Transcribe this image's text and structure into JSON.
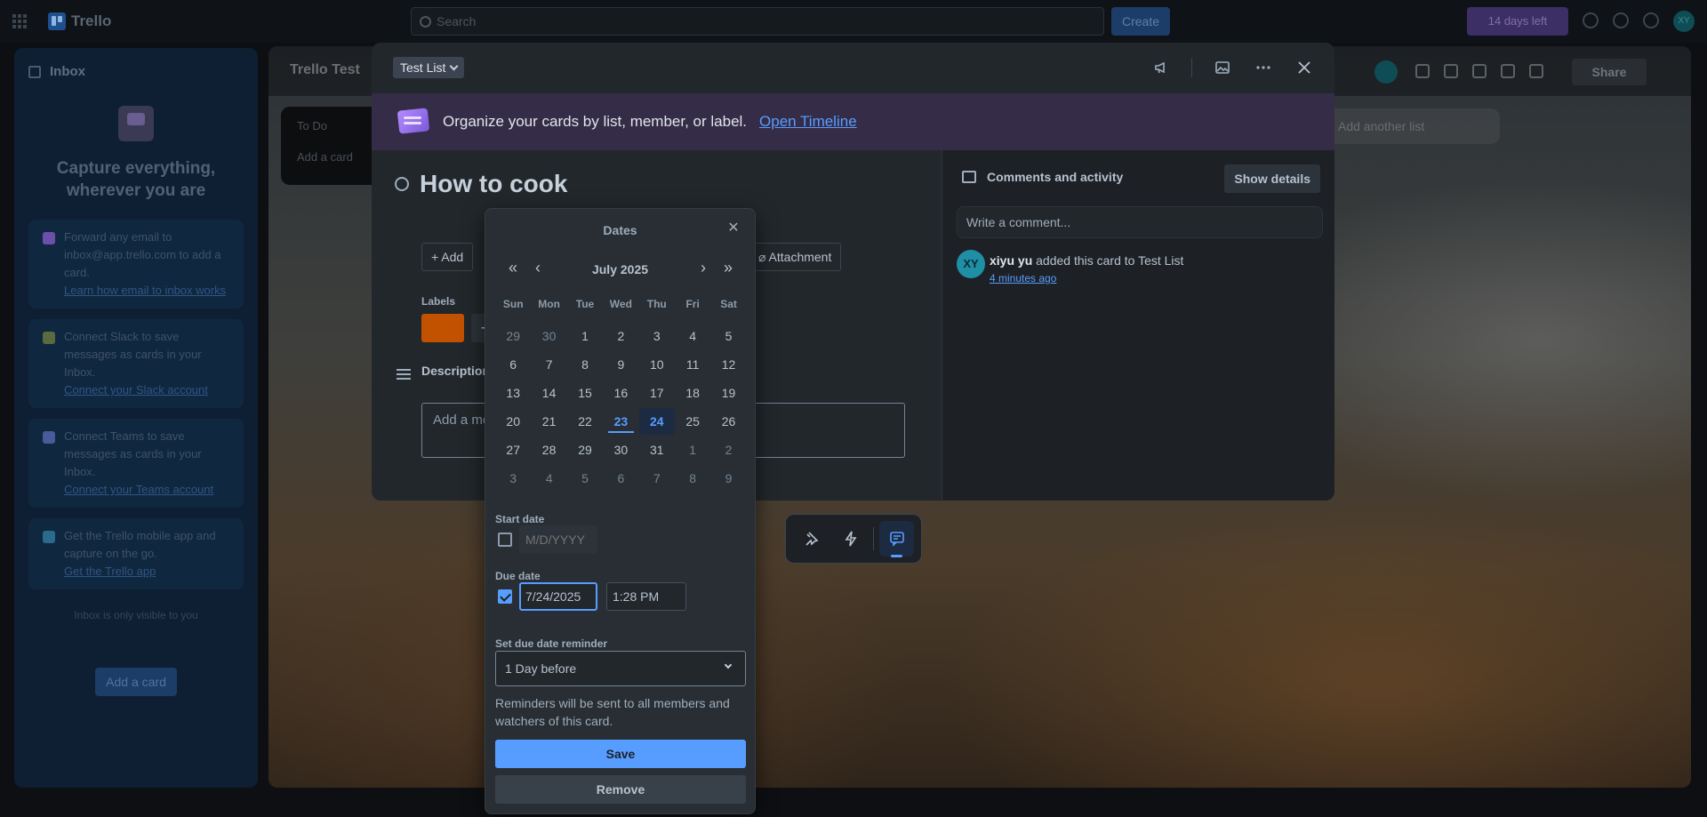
{
  "topbar": {
    "app_name": "Trello",
    "search_placeholder": "Search",
    "create_label": "Create",
    "trial_label": "14 days left",
    "avatar_initials": "XY"
  },
  "inbox": {
    "title": "Inbox",
    "heading": "Capture everything, wherever you are",
    "tips": [
      {
        "text": "Forward any email to inbox@app.trello.com to add a card.",
        "link": "Learn how email to inbox works",
        "color": "#6b4fa8"
      },
      {
        "text": "Connect Slack to save messages as cards in your Inbox.",
        "link": "Connect your Slack account",
        "color": "#5a6b3f"
      },
      {
        "text": "Connect Teams to save messages as cards in your Inbox.",
        "link": "Connect your Teams account",
        "color": "#4a5a9a"
      },
      {
        "text": "Get the Trello mobile app and capture on the go.",
        "link": "Get the Trello app",
        "color": "#2a6a8a"
      }
    ],
    "visibility_note": "Inbox is only visible to you",
    "add_card_label": "Add a card"
  },
  "board": {
    "title": "Trello Test",
    "list_todo": "To Do",
    "add_card": "Add a card",
    "add_list": "Add another list",
    "share_label": "Share"
  },
  "modal": {
    "list_name": "Test List",
    "banner_text": "Organize your cards by list, member, or label.",
    "banner_link": "Open Timeline",
    "card_title": "How to cook",
    "add_label": "Add",
    "attachment_label": "Attachment",
    "labels_heading": "Labels",
    "label_color": "#c25100",
    "description_heading": "Description",
    "description_placeholder": "Add a more detailed description...",
    "comments_heading": "Comments and activity",
    "show_details_label": "Show details",
    "comment_placeholder": "Write a comment...",
    "activity": {
      "avatar": "XY",
      "user": "xiyu yu",
      "action": "added this card to Test List",
      "time": "4 minutes ago"
    }
  },
  "dates": {
    "title": "Dates",
    "month_label": "July 2025",
    "weekdays": [
      "Sun",
      "Mon",
      "Tue",
      "Wed",
      "Thu",
      "Fri",
      "Sat"
    ],
    "weeks": [
      [
        {
          "d": "29",
          "m": true
        },
        {
          "d": "30",
          "m": true
        },
        {
          "d": "1"
        },
        {
          "d": "2"
        },
        {
          "d": "3"
        },
        {
          "d": "4"
        },
        {
          "d": "5"
        }
      ],
      [
        {
          "d": "6"
        },
        {
          "d": "7"
        },
        {
          "d": "8"
        },
        {
          "d": "9"
        },
        {
          "d": "10"
        },
        {
          "d": "11"
        },
        {
          "d": "12"
        }
      ],
      [
        {
          "d": "13"
        },
        {
          "d": "14"
        },
        {
          "d": "15"
        },
        {
          "d": "16"
        },
        {
          "d": "17"
        },
        {
          "d": "18"
        },
        {
          "d": "19"
        }
      ],
      [
        {
          "d": "20"
        },
        {
          "d": "21"
        },
        {
          "d": "22"
        },
        {
          "d": "23",
          "today": true
        },
        {
          "d": "24",
          "selected": true
        },
        {
          "d": "25"
        },
        {
          "d": "26"
        }
      ],
      [
        {
          "d": "27"
        },
        {
          "d": "28"
        },
        {
          "d": "29"
        },
        {
          "d": "30"
        },
        {
          "d": "31"
        },
        {
          "d": "1",
          "m": true
        },
        {
          "d": "2",
          "m": true
        }
      ],
      [
        {
          "d": "3",
          "m": true
        },
        {
          "d": "4",
          "m": true
        },
        {
          "d": "5",
          "m": true
        },
        {
          "d": "6",
          "m": true
        },
        {
          "d": "7",
          "m": true
        },
        {
          "d": "8",
          "m": true
        },
        {
          "d": "9",
          "m": true
        }
      ]
    ],
    "start_date_label": "Start date",
    "start_date_placeholder": "M/D/YYYY",
    "start_date_checked": false,
    "due_date_label": "Due date",
    "due_date_value": "7/24/2025",
    "due_time_value": "1:28 PM",
    "due_date_checked": true,
    "reminder_label": "Set due date reminder",
    "reminder_value": "1 Day before",
    "reminder_note": "Reminders will be sent to all members and watchers of this card.",
    "save_label": "Save",
    "remove_label": "Remove"
  },
  "colors": {
    "accent": "#579dff",
    "modal_bg": "#22272b",
    "banner_bg": "#352c47"
  }
}
